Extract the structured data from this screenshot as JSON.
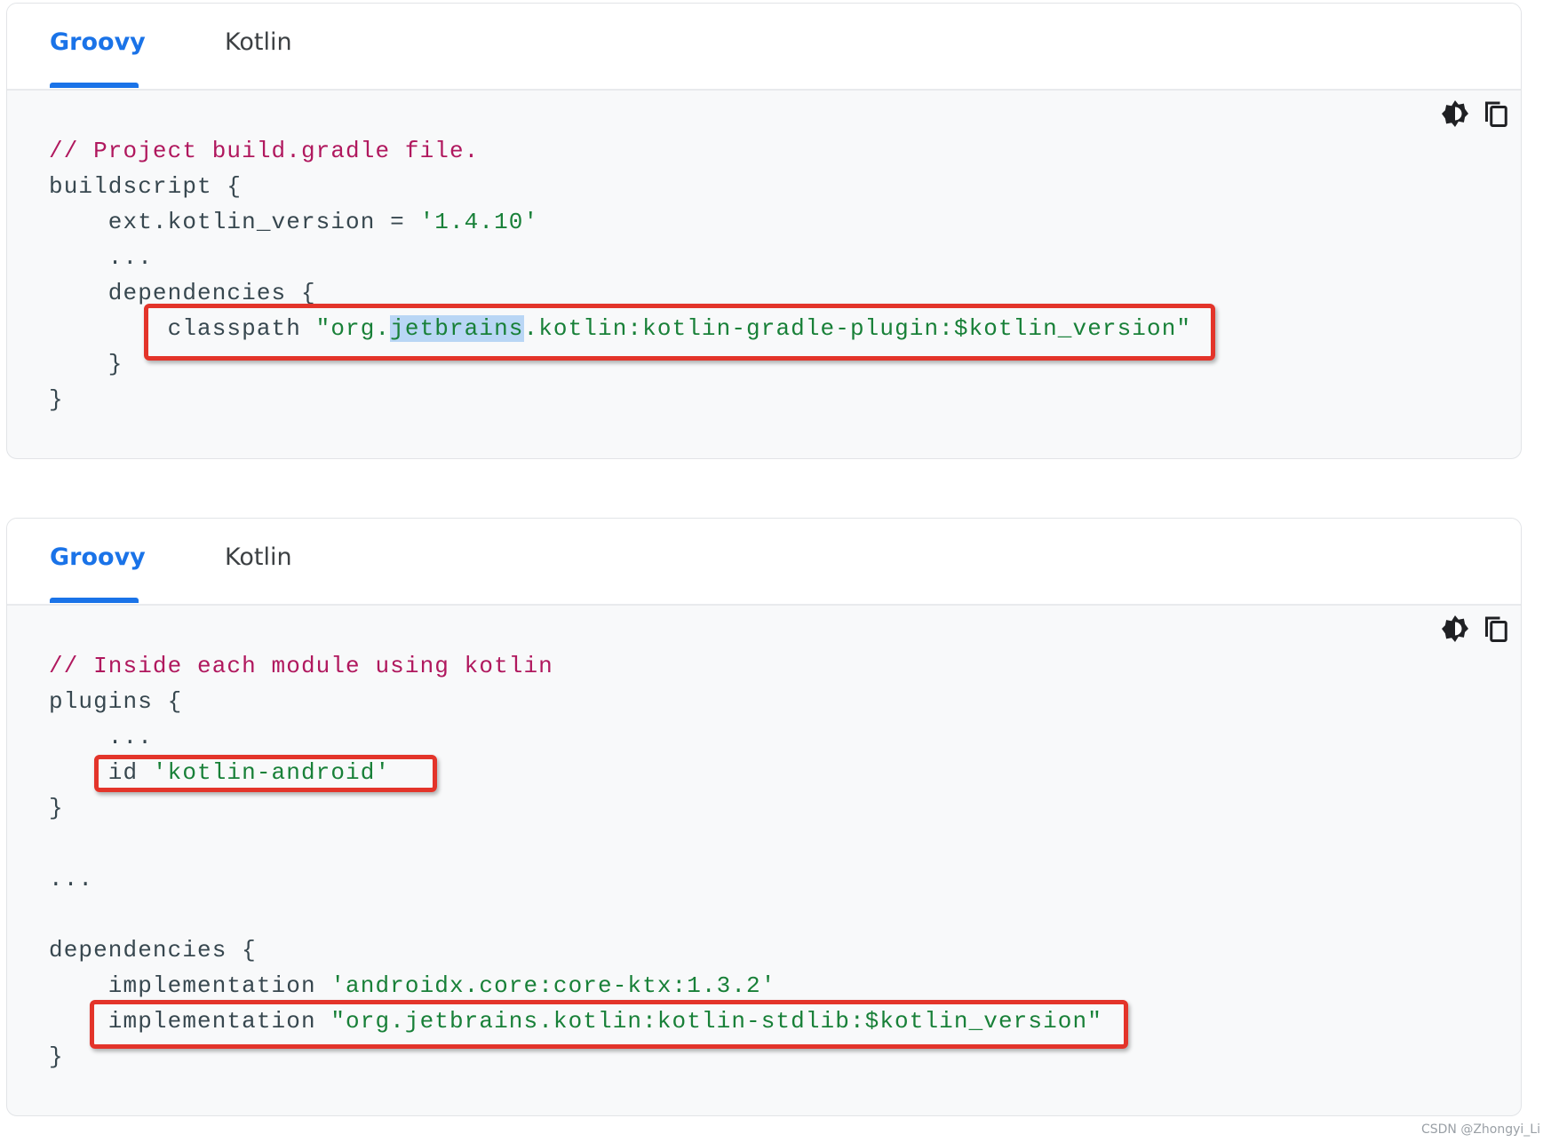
{
  "colors": {
    "accent": "#1a73e8",
    "comment": "#b0185e",
    "string": "#188038",
    "highlight_box": "#e3342a"
  },
  "cards": [
    {
      "tabs": [
        {
          "label": "Groovy",
          "active": true
        },
        {
          "label": "Kotlin",
          "active": false
        }
      ],
      "icons": [
        "theme-toggle-icon",
        "copy-icon"
      ],
      "lines": [
        [
          {
            "t": "// Project build.gradle file.",
            "c": "cm"
          }
        ],
        [
          {
            "t": "buildscript {",
            "c": ""
          }
        ],
        [
          {
            "t": "    ext.kotlin_version = ",
            "c": ""
          },
          {
            "t": "'1.4.10'",
            "c": "str"
          }
        ],
        [
          {
            "t": "    ...",
            "c": ""
          }
        ],
        [
          {
            "t": "    dependencies {",
            "c": ""
          }
        ],
        [
          {
            "t": "        classpath ",
            "c": ""
          },
          {
            "t": "\"org.",
            "c": "str"
          },
          {
            "t": "jetbrains",
            "c": "str sel"
          },
          {
            "t": ".kotlin:kotlin-gradle-plugin:$kotlin_version\"",
            "c": "str"
          }
        ],
        [
          {
            "t": "    }",
            "c": ""
          }
        ],
        [
          {
            "t": "}",
            "c": ""
          }
        ]
      ]
    },
    {
      "tabs": [
        {
          "label": "Groovy",
          "active": true
        },
        {
          "label": "Kotlin",
          "active": false
        }
      ],
      "icons": [
        "theme-toggle-icon",
        "copy-icon"
      ],
      "lines": [
        [
          {
            "t": "// Inside each module using kotlin",
            "c": "cm"
          }
        ],
        [
          {
            "t": "plugins {",
            "c": ""
          }
        ],
        [
          {
            "t": "    ...",
            "c": ""
          }
        ],
        [
          {
            "t": "    id ",
            "c": ""
          },
          {
            "t": "'kotlin-android'",
            "c": "str"
          }
        ],
        [
          {
            "t": "}",
            "c": ""
          }
        ],
        [
          {
            "t": "",
            "c": ""
          }
        ],
        [
          {
            "t": "...",
            "c": ""
          }
        ],
        [
          {
            "t": "",
            "c": ""
          }
        ],
        [
          {
            "t": "dependencies {",
            "c": ""
          }
        ],
        [
          {
            "t": "    implementation ",
            "c": ""
          },
          {
            "t": "'androidx.core:core-ktx:1.3.2'",
            "c": "str"
          }
        ],
        [
          {
            "t": "    implementation ",
            "c": ""
          },
          {
            "t": "\"org.jetbrains.kotlin:kotlin-stdlib:$kotlin_version\"",
            "c": "str"
          }
        ],
        [
          {
            "t": "}",
            "c": ""
          }
        ]
      ]
    }
  ],
  "watermark": "CSDN @Zhongyi_Li"
}
